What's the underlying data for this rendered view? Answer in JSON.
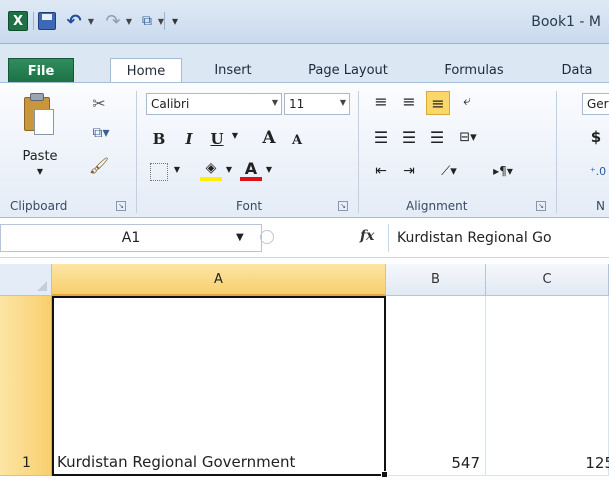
{
  "app": {
    "logo_letter": "X",
    "window_title": "Book1 - M"
  },
  "quick_access": {
    "undo_icon": "undo-icon",
    "redo_icon": "redo-icon"
  },
  "tabs": [
    "File",
    "Home",
    "Insert",
    "Page Layout",
    "Formulas",
    "Data"
  ],
  "ribbon": {
    "clipboard": {
      "paste_label": "Paste",
      "group_label": "Clipboard"
    },
    "font": {
      "font_name": "Calibri",
      "font_size": "11",
      "bold": "B",
      "italic": "I",
      "underline": "U",
      "grow": "A",
      "shrink": "A",
      "font_color": "A",
      "group_label": "Font"
    },
    "alignment": {
      "group_label": "Alignment"
    },
    "number": {
      "format_partial": "Ger",
      "currency": "$",
      "group_label_partial": "N"
    }
  },
  "formula_bar": {
    "name_box": "A1",
    "fx": "fx",
    "content": "Kurdistan Regional Go"
  },
  "grid": {
    "columns": [
      "A",
      "B",
      "C"
    ],
    "rows": [
      {
        "row": "1",
        "cells": [
          "Kurdistan Regional Government",
          "547",
          "125"
        ]
      }
    ]
  },
  "colors": {
    "accent_file": "#1e7145",
    "selection_header": "#f8cf6e",
    "ribbon_bg": "#e4ecf7"
  }
}
